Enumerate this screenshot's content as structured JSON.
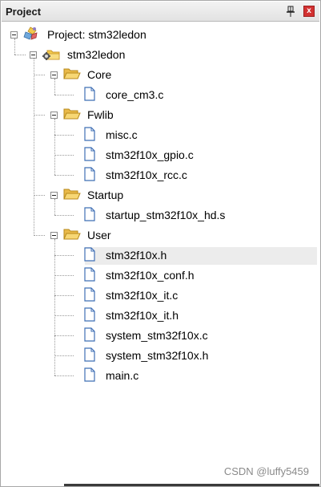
{
  "panel": {
    "title": "Project",
    "pin_glyph": "↑",
    "close_glyph": "x"
  },
  "tree": {
    "root": {
      "label": "Project: stm32ledon",
      "icon": "project-icon"
    },
    "target": {
      "label": "stm32ledon",
      "icon": "target-icon"
    },
    "groups": [
      {
        "label": "Core",
        "icon": "folder-open-icon",
        "files": [
          "core_cm3.c"
        ]
      },
      {
        "label": "Fwlib",
        "icon": "folder-open-icon",
        "files": [
          "misc.c",
          "stm32f10x_gpio.c",
          "stm32f10x_rcc.c"
        ]
      },
      {
        "label": "Startup",
        "icon": "folder-open-icon",
        "files": [
          "startup_stm32f10x_hd.s"
        ]
      },
      {
        "label": "User",
        "icon": "folder-open-icon",
        "files": [
          "stm32f10x.h",
          "stm32f10x_conf.h",
          "stm32f10x_it.c",
          "stm32f10x_it.h",
          "system_stm32f10x.c",
          "system_stm32f10x.h",
          "main.c"
        ]
      }
    ]
  },
  "watermark": "CSDN @luffy5459",
  "colors": {
    "folder": "#f2c94c",
    "folder_dark": "#c9962a",
    "close": "#d23131",
    "selection": "#ececec"
  }
}
